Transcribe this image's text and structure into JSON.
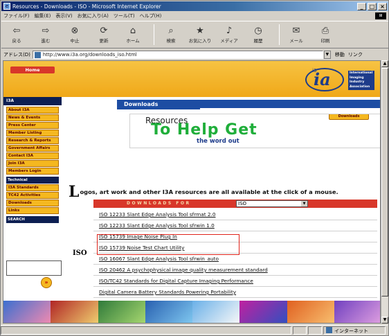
{
  "window": {
    "title": "Resources - Downloads - ISO - Microsoft Internet Explorer",
    "buttons": [
      "_",
      "□",
      "×"
    ]
  },
  "menubar": {
    "items": [
      "ファイル(F)",
      "編集(E)",
      "表示(V)",
      "お気に入り(A)",
      "ツール(T)",
      "ヘルプ(H)"
    ]
  },
  "toolbar": {
    "buttons": [
      {
        "label": "戻る",
        "icon": "back-arrow-icon",
        "glyph": "⇦"
      },
      {
        "label": "進む",
        "icon": "forward-arrow-icon",
        "glyph": "⇨"
      },
      {
        "label": "中止",
        "icon": "stop-icon",
        "glyph": "⊗"
      },
      {
        "label": "更新",
        "icon": "refresh-icon",
        "glyph": "⟳"
      },
      {
        "label": "ホーム",
        "icon": "home-icon",
        "glyph": "⌂"
      },
      {
        "label": "検索",
        "icon": "search-icon",
        "glyph": "⌕"
      },
      {
        "label": "お気に入り",
        "icon": "favorites-icon",
        "glyph": "★"
      },
      {
        "label": "メディア",
        "icon": "media-icon",
        "glyph": "♪"
      },
      {
        "label": "履歴",
        "icon": "history-icon",
        "glyph": "◷"
      },
      {
        "label": "メール",
        "icon": "mail-icon",
        "glyph": "✉"
      },
      {
        "label": "印刷",
        "icon": "print-icon",
        "glyph": "⎙"
      }
    ]
  },
  "address": {
    "label": "アドレス(D)",
    "url": "http://www.i3a.org/downloads_iso.html",
    "go_label": "移動",
    "links_label": "リンク"
  },
  "site": {
    "home_button": "Home",
    "logo": {
      "mark": "ia",
      "superscript": "i3",
      "wordmark": "International Imaging Industry Association"
    },
    "sidebar_header": "I3A",
    "sidebar_items": [
      "About I3A",
      "News & Events",
      "Press Center",
      "Member Listing",
      "Research & Reports",
      "Government Affairs",
      "Contact I3A",
      "Join I3A",
      "Members Login"
    ],
    "sidebar_subheader": "Technical",
    "sidebar_sub_items": [
      "I3A Standards",
      "TC42 Activities",
      "Downloads",
      "Links"
    ],
    "search_label": "SEARCH",
    "search_go": "»",
    "downloads_tab": "Downloads",
    "downloads_side_button": "Downloads",
    "hero": {
      "line1": "Resources",
      "line2": "To Help Get",
      "line3": "the word out"
    },
    "intro_dropcap": "L",
    "intro_text": "ogos, art work and other I3A resources are all available at the click of a mouse.",
    "downloads_for_label": "DOWNLOADS FOR",
    "downloads_for_selected": "ISO",
    "iso_heading": "ISO",
    "links": [
      "ISO 12233 Slant Edge Analysis Tool sfrmat 2.0",
      "ISO 12233 Slant Edge Analysis Tool sfrwin 1.0",
      "ISO 15739 Image Noise Plug In",
      "ISO 15739 Noise Test Chart Utility",
      "ISO 16067 Slant Edge Analysis Tool sfrwin_auto",
      "ISO 20462 A psychophysical image quality measurement standard",
      "ISO/TC42 Standards for Digital Capture Imaging Performance",
      "Digital Camera Battery Standards Powering Portability"
    ]
  },
  "status": {
    "text": "",
    "zone": "インターネット"
  },
  "colors": {
    "header_gold": "#f0a818",
    "nav_blue": "#1d4da3",
    "downloads_red": "#d8372a",
    "highlight_red": "#e0231a",
    "hero_green": "#1fae3a"
  }
}
